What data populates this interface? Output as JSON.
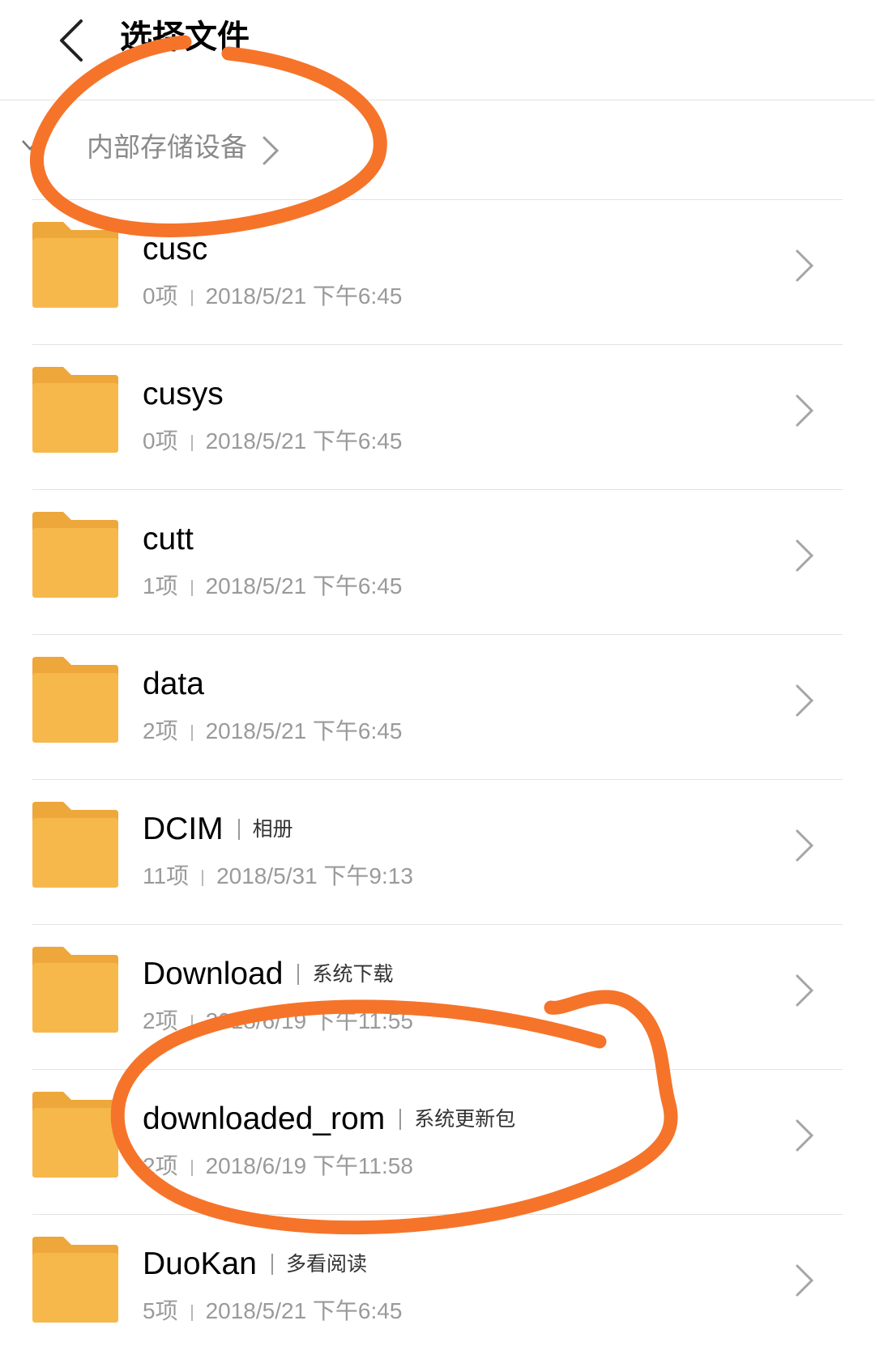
{
  "header": {
    "title": "选择文件",
    "back_icon": "chevron-left-icon"
  },
  "breadcrumb": {
    "label": "内部存储设备",
    "icon": "chevron-right-icon"
  },
  "colors": {
    "folder": "#F7B84B",
    "folder_tab": "#EEA73A",
    "annotation": "#F5742A"
  },
  "files": [
    {
      "name": "cusc",
      "tag": "",
      "count": "0项",
      "date": "2018/5/21 下午6:45"
    },
    {
      "name": "cusys",
      "tag": "",
      "count": "0项",
      "date": "2018/5/21 下午6:45"
    },
    {
      "name": "cutt",
      "tag": "",
      "count": "1项",
      "date": "2018/5/21 下午6:45"
    },
    {
      "name": "data",
      "tag": "",
      "count": "2项",
      "date": "2018/5/21 下午6:45"
    },
    {
      "name": "DCIM",
      "tag": "相册",
      "count": "11项",
      "date": "2018/5/31 下午9:13"
    },
    {
      "name": "Download",
      "tag": "系统下载",
      "count": "2项",
      "date": "2018/6/19 下午11:55"
    },
    {
      "name": "downloaded_rom",
      "tag": "系统更新包",
      "count": "2项",
      "date": "2018/6/19 下午11:58"
    },
    {
      "name": "DuoKan",
      "tag": "多看阅读",
      "count": "5项",
      "date": "2018/5/21 下午6:45"
    }
  ]
}
